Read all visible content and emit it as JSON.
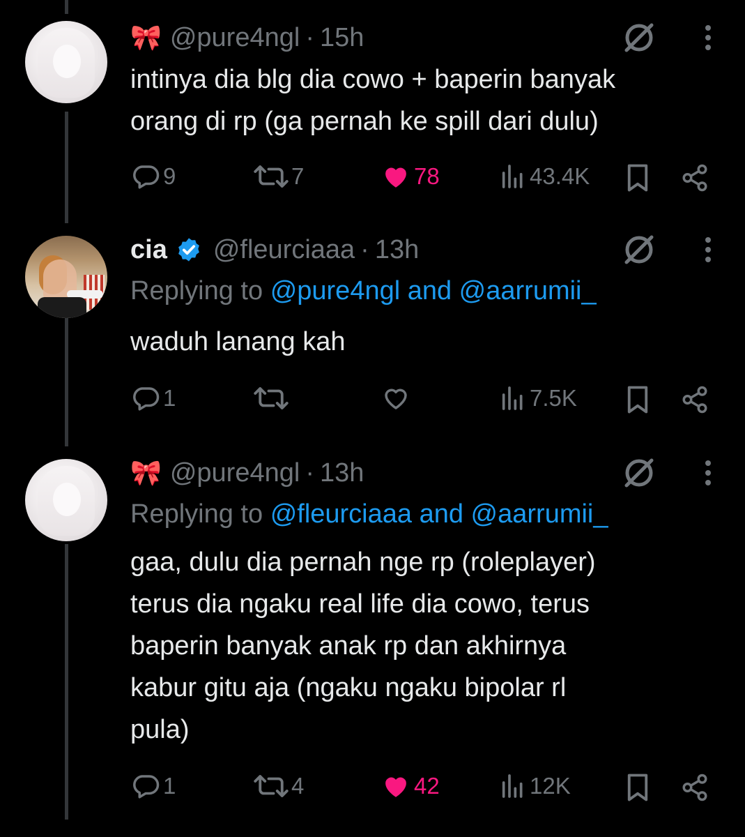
{
  "colors": {
    "accent": "#1d9bf0",
    "like": "#f91880",
    "muted": "#71767b",
    "text": "#e7e9ea",
    "background": "#000000"
  },
  "tweets": [
    {
      "avatar_icon": "anime-girl-avatar",
      "emoji": "🎀",
      "display_name": "",
      "handle": "@pure4ngl",
      "time": "15h",
      "separator": "·",
      "replying_label": "",
      "replying_to": "",
      "text_lines": [
        "intinya dia blg dia cowo + baperin banyak",
        "orang di rp (ga pernah ke spill dari dulu)"
      ],
      "replies": "9",
      "reposts": "7",
      "likes": "78",
      "liked": true,
      "views": "43.4K"
    },
    {
      "avatar_icon": "photo-avatar",
      "emoji": "",
      "display_name": "cia",
      "verified": true,
      "handle": "@fleurciaaa",
      "time": "13h",
      "separator": "·",
      "replying_label": "Replying to",
      "replying_to": "@pure4ngl and @aarrumii_",
      "text_lines": [
        "waduh lanang kah"
      ],
      "replies": "1",
      "reposts": "",
      "likes": "",
      "liked": false,
      "views": "7.5K"
    },
    {
      "avatar_icon": "anime-girl-avatar",
      "emoji": "🎀",
      "display_name": "",
      "handle": "@pure4ngl",
      "time": "13h",
      "separator": "·",
      "replying_label": "Replying to",
      "replying_to": "@fleurciaaa and @aarrumii_",
      "text_lines": [
        "gaa, dulu dia pernah nge rp (roleplayer)",
        "terus dia ngaku real life dia cowo, terus",
        "baperin banyak anak rp dan akhirnya",
        "kabur gitu aja (ngaku ngaku bipolar rl",
        "pula)"
      ],
      "replies": "1",
      "reposts": "4",
      "likes": "42",
      "liked": true,
      "views": "12K"
    }
  ]
}
